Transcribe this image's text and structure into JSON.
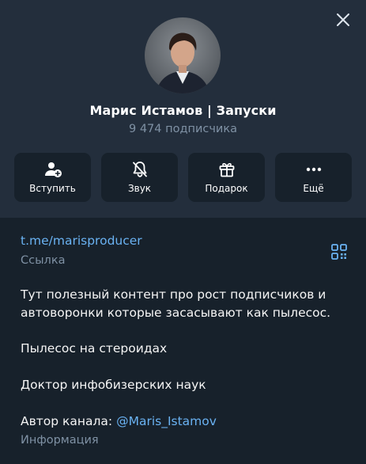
{
  "profile": {
    "name": "Марис Истамов | Запуски",
    "subscribers": "9 474 подписчика"
  },
  "actions": [
    {
      "label": "Вступить",
      "icon": "add-user-icon"
    },
    {
      "label": "Звук",
      "icon": "bell-muted-icon"
    },
    {
      "label": "Подарок",
      "icon": "gift-icon"
    },
    {
      "label": "Ещё",
      "icon": "more-dots-icon"
    }
  ],
  "link": {
    "url": "t.me/marisproducer",
    "caption": "Ссылка"
  },
  "description": {
    "p1": "Тут полезный контент про рост подписчиков и автоворонки которые засасывают как пылесос.",
    "p2": "Пылесос на стероидах",
    "p3": "Доктор инфобизерских наук",
    "author_prefix": "Автор канала: ",
    "author_handle": "@Maris_Istamov",
    "caption": "Информация"
  },
  "colors": {
    "header_bg": "#232e3c",
    "body_bg": "#17212b",
    "accent": "#6ab2f2",
    "muted": "#7f91a4"
  }
}
